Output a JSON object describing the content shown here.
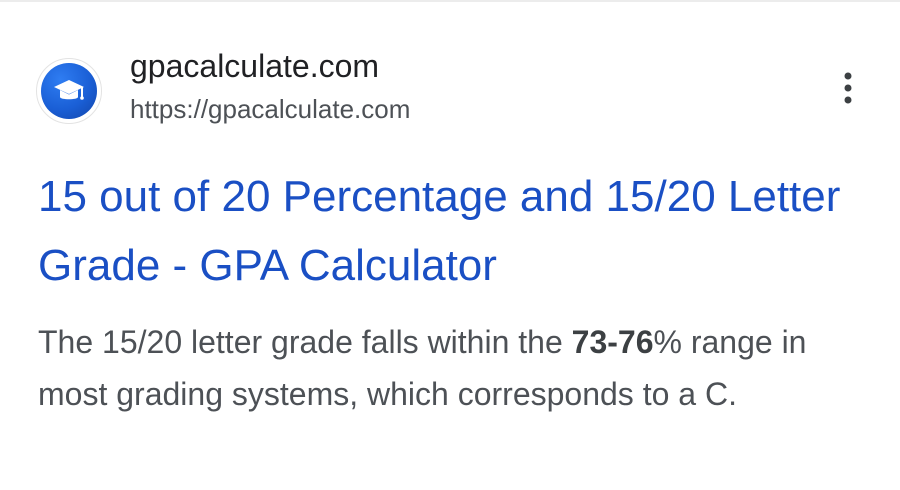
{
  "result": {
    "site_name": "gpacalculate.com",
    "site_url": "https://gpacalculate.com",
    "title": "15 out of 20 Percentage and 15/20 Letter Grade - GPA Calculator",
    "snippet": {
      "before": "The 15/20 letter grade falls within the ",
      "highlight": "73-76",
      "after": "% range in most grading systems, which corresponds to a C."
    },
    "favicon_icon": "graduation-cap-icon",
    "more_icon": "more-vert-icon"
  },
  "colors": {
    "title_link": "#1a4fc4",
    "favicon_bg": "#1a5fd6",
    "text_primary": "#202124",
    "text_secondary": "#4d5156"
  }
}
